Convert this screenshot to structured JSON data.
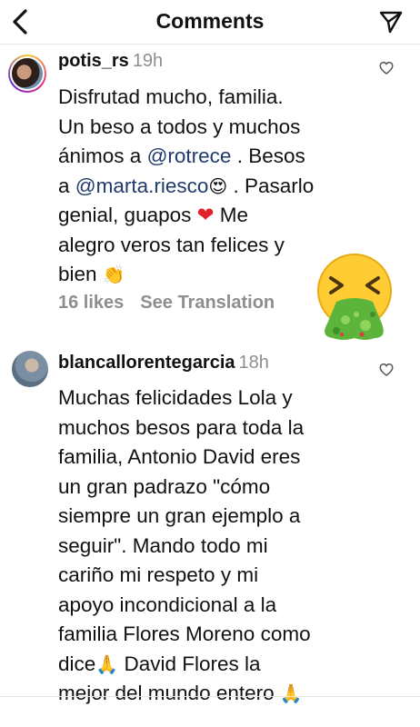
{
  "header": {
    "title": "Comments"
  },
  "comments": [
    {
      "username": "potis_rs",
      "time": "19h",
      "text_parts": [
        "Disfrutad mucho, familia.",
        "Un beso a todos y muchos",
        "ánimos a ",
        "@rotrece",
        " . Besos",
        "a ",
        "@marta.riesco",
        " . Pasarlo",
        "genial, guapos ",
        " Me",
        "alegro veros tan felices y",
        "bien "
      ],
      "likes": "16 likes",
      "translate": "See Translation"
    },
    {
      "username": "blancallorentegarcia",
      "time": "18h",
      "lines": [
        "Muchas felicidades Lola y",
        "muchos besos para toda la",
        "familia, Antonio David eres",
        "un gran padrazo \"cómo",
        "siempre un gran ejemplo a",
        "seguir\". Mando todo mi",
        "cariño mi respeto y mi",
        "apoyo incondicional a la",
        "familia Flores Moreno como",
        "dice",
        " David Flores la",
        "mejor del mundo entero "
      ]
    }
  ],
  "icons": {
    "back": "chevron-left-icon",
    "send": "paper-plane-icon",
    "like": "heart-outline-icon",
    "sticker": "vomiting-face-emoji"
  },
  "colors": {
    "mention": "#1f3a6b",
    "muted": "#8e8e8e",
    "border": "#e6e6e6"
  }
}
